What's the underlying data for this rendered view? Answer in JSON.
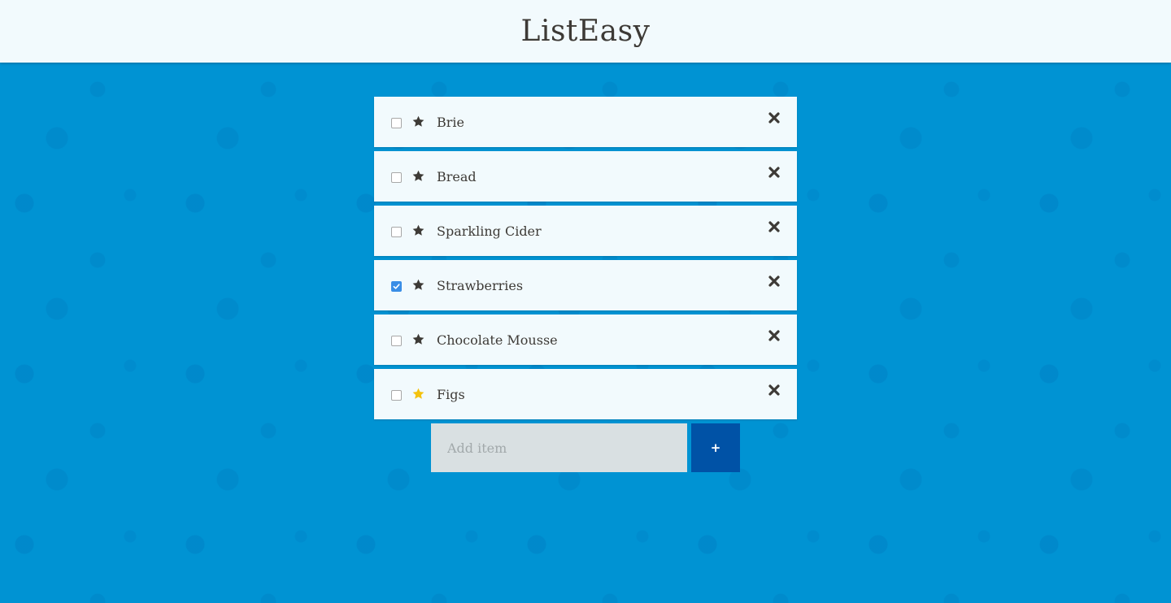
{
  "app": {
    "title": "ListEasy"
  },
  "colors": {
    "background": "#0093d3",
    "card": "#f2fafd",
    "text": "#3d3a36",
    "star_default": "#3d3a36",
    "star_favorite": "#f4c20d",
    "checkbox_checked": "#3a8ee6",
    "add_button": "#0052a6",
    "input_background": "#d9e0e2"
  },
  "items": [
    {
      "label": "Brie",
      "checked": false,
      "favorite": false
    },
    {
      "label": "Bread",
      "checked": false,
      "favorite": false
    },
    {
      "label": "Sparkling Cider",
      "checked": false,
      "favorite": false
    },
    {
      "label": "Strawberries",
      "checked": true,
      "favorite": false
    },
    {
      "label": "Chocolate Mousse",
      "checked": false,
      "favorite": false
    },
    {
      "label": "Figs",
      "checked": false,
      "favorite": true
    }
  ],
  "add_form": {
    "placeholder": "Add item",
    "value": "",
    "button_label": "+"
  },
  "icons": {
    "checkbox": "checkbox-icon",
    "star": "star-icon",
    "delete": "close-x-icon",
    "check": "check-icon"
  }
}
